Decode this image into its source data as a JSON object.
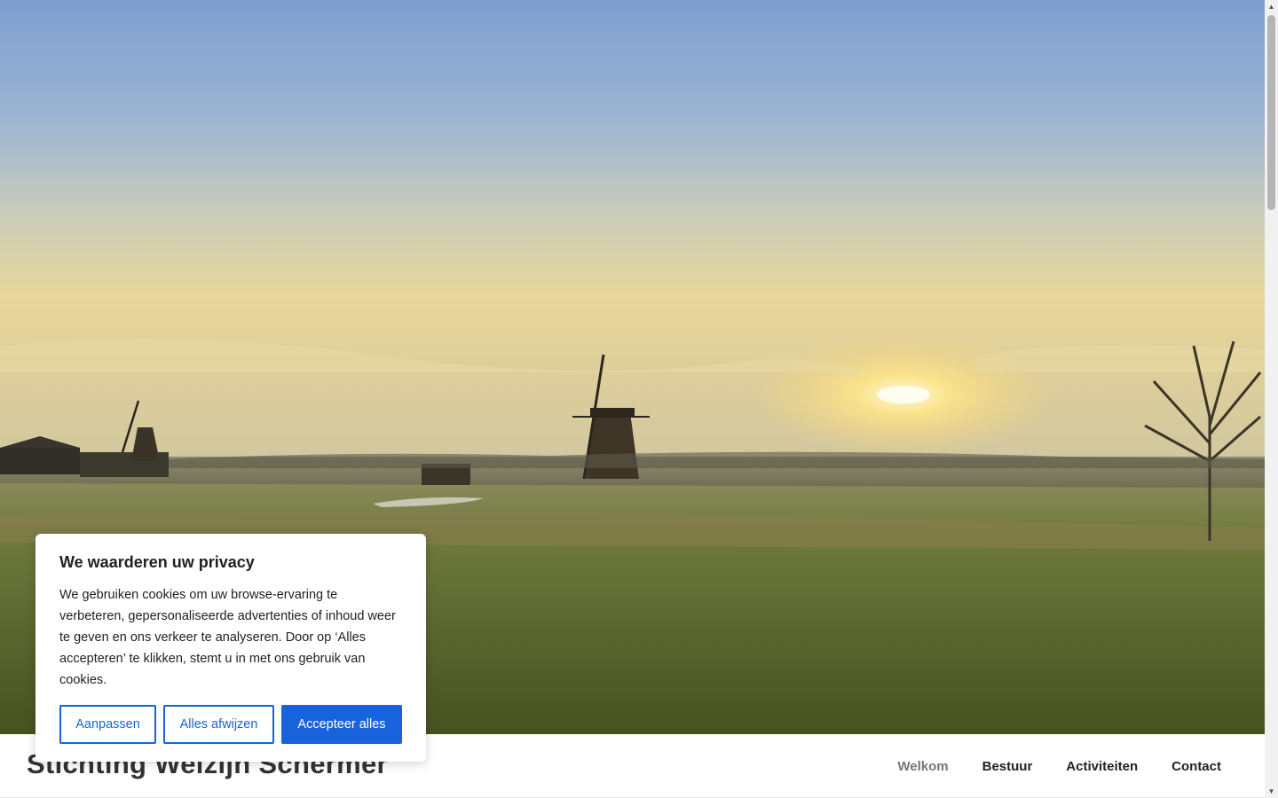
{
  "hero": {
    "description_icon": "windmill-landscape-image"
  },
  "site": {
    "title": "Stichting Welzijn Schermer"
  },
  "nav": {
    "items": [
      {
        "label": "Welkom",
        "current": true
      },
      {
        "label": "Bestuur",
        "current": false
      },
      {
        "label": "Activiteiten",
        "current": false
      },
      {
        "label": "Contact",
        "current": false
      }
    ]
  },
  "cookie": {
    "title": "We waarderen uw privacy",
    "text": "We gebruiken cookies om uw browse-ervaring te verbeteren, gepersonaliseerde advertenties of inhoud weer te geven en ons verkeer te analyseren. Door op ‘Alles accepteren’ te klikken, stemt u in met ons gebruik van cookies.",
    "customize_label": "Aanpassen",
    "reject_label": "Alles afwijzen",
    "accept_label": "Accepteer alles"
  },
  "colors": {
    "accent": "#1863dc",
    "text": "#212121",
    "nav_current": "#767676"
  }
}
